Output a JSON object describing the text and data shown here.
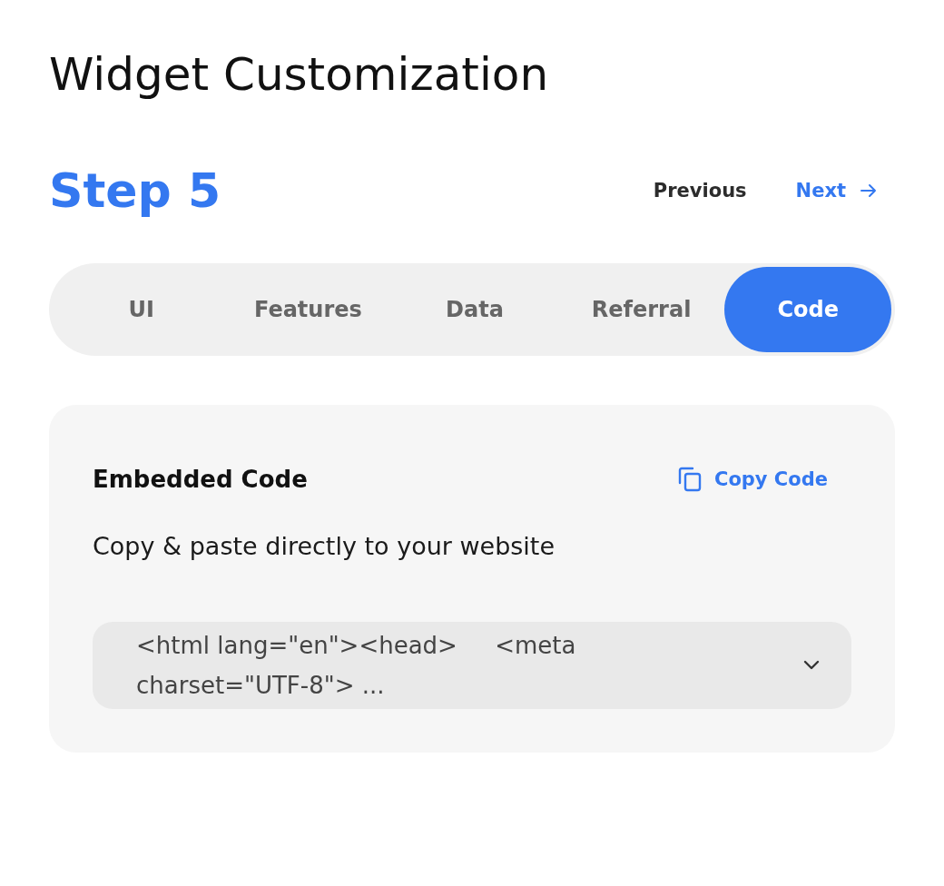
{
  "page_title": "Widget Customization",
  "step": {
    "label": "Step 5",
    "previous": "Previous",
    "next": "Next"
  },
  "tabs": [
    {
      "label": "UI",
      "selected": false
    },
    {
      "label": "Features",
      "selected": false
    },
    {
      "label": "Data",
      "selected": false
    },
    {
      "label": "Referral",
      "selected": false
    },
    {
      "label": "Code",
      "selected": true
    }
  ],
  "card": {
    "title": "Embedded Code",
    "copy_button": "Copy Code",
    "description": "Copy & paste directly to your website",
    "code_preview": "<html lang=\"en\"><head>     <meta charset=\"UTF-8\"> ...",
    "expanded": false
  }
}
